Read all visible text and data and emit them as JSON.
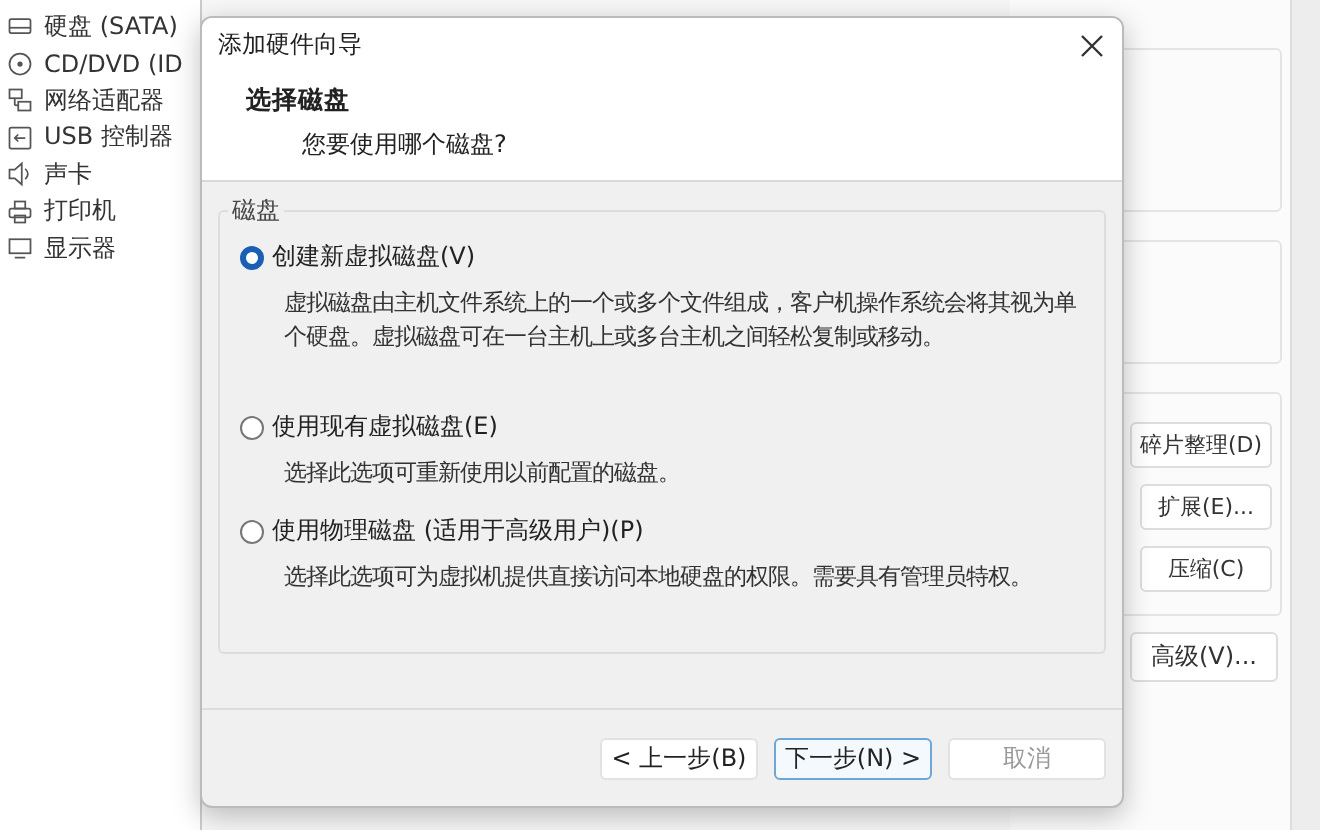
{
  "sidebar": {
    "items": [
      {
        "kind": "disk",
        "label": "硬盘 (SATA)"
      },
      {
        "kind": "cd",
        "label": "CD/DVD (ID"
      },
      {
        "kind": "network",
        "label": "网络适配器"
      },
      {
        "kind": "usb",
        "label": "USB 控制器"
      },
      {
        "kind": "sound",
        "label": "声卡"
      },
      {
        "kind": "printer",
        "label": "打印机"
      },
      {
        "kind": "display",
        "label": "显示器"
      }
    ]
  },
  "side_buttons": [
    "碎片整理(D)",
    "扩展(E)...",
    "压缩(C)"
  ],
  "advanced_button": "高级(V)...",
  "dialog": {
    "title": "添加硬件向导",
    "header_title": "选择磁盘",
    "header_subtitle": "您要使用哪个磁盘?",
    "group_label": "磁盘",
    "options": [
      {
        "label": "创建新虚拟磁盘(V)",
        "description": "虚拟磁盘由主机文件系统上的一个或多个文件组成，客户机操作系统会将其视为单个硬盘。虚拟磁盘可在一台主机上或多台主机之间轻松复制或移动。",
        "selected": true
      },
      {
        "label": "使用现有虚拟磁盘(E)",
        "description": "选择此选项可重新使用以前配置的磁盘。",
        "selected": false
      },
      {
        "label": "使用物理磁盘 (适用于高级用户)(P)",
        "description": "选择此选项可为虚拟机提供直接访问本地硬盘的权限。需要具有管理员特权。",
        "selected": false
      }
    ],
    "buttons": [
      {
        "label": "< 上一步(B)",
        "default": false,
        "disabled": false
      },
      {
        "label": "下一步(N) >",
        "default": true,
        "disabled": false
      },
      {
        "label": "取消",
        "default": false,
        "disabled": true
      }
    ]
  }
}
